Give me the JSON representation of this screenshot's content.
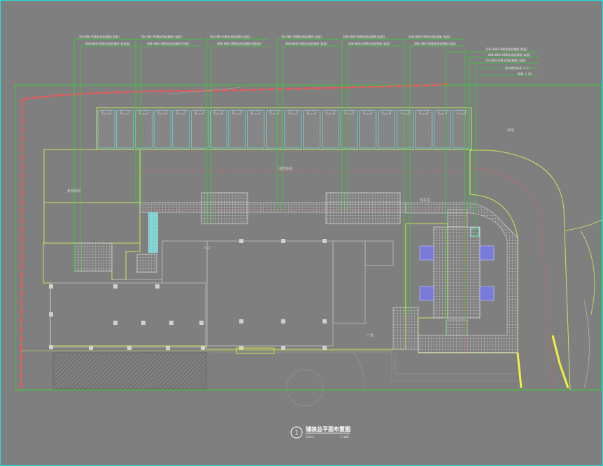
{
  "drawing": {
    "title": "铺装总平面布置图",
    "number": "1",
    "scale_left": "SCALE",
    "scale_right": "1:100"
  },
  "notes": [
    {
      "l1": "50×200×50厚花岗岩铺装(烧面)",
      "l2": "600×600×30厚花岗岩铺装(荔枝面)"
    },
    {
      "l1": "50×200×50厚花岗岩铺装(烧面)",
      "l2": "600×600×30厚花岗岩铺装(光面)"
    },
    {
      "l1": "50×200×50厚花岗岩铺装(烧面)",
      "l2": "600×600×30厚花岗岩铺装(荔枝面)"
    },
    {
      "l1": "50×200×50厚花岗岩铺装(烧面)",
      "l2": "600×600×30厚花岗岩铺装(烧面)"
    },
    {
      "l1": "300×300×50厚花岗岩铺装(烧面)",
      "l2": "600×600×30厚花岗岩铺装(烧面)"
    },
    {
      "l1": "150×300×50厚花岗岩铺装(烧面)",
      "l2": "300×300×30厚花岗岩铺装(烧面)"
    }
  ],
  "right_notes": [
    "150×300×50厚花岗岩铺装(烧面)",
    "600×600×30厚花岗岩铺装(烧面)",
    "50×200×50厚花岗岩铺装(烧面)"
  ],
  "elevation": {
    "l1": "室内地坪标高 0.17",
    "l2": "标高 1.01"
  },
  "labels": {
    "a": "景观绿化",
    "b": "停车位",
    "c": "入口",
    "d": "消防通道",
    "e": "广场",
    "f": "绿地"
  },
  "colors": {
    "background": "#7f7f7f",
    "frame": "#22e0e0",
    "leader": "#32d232",
    "redline": "#e85a5a",
    "building": "#c8e65a",
    "paving": "#d8d8d8",
    "planter": "#78e6e6",
    "fountain": "#7a7ad8"
  }
}
